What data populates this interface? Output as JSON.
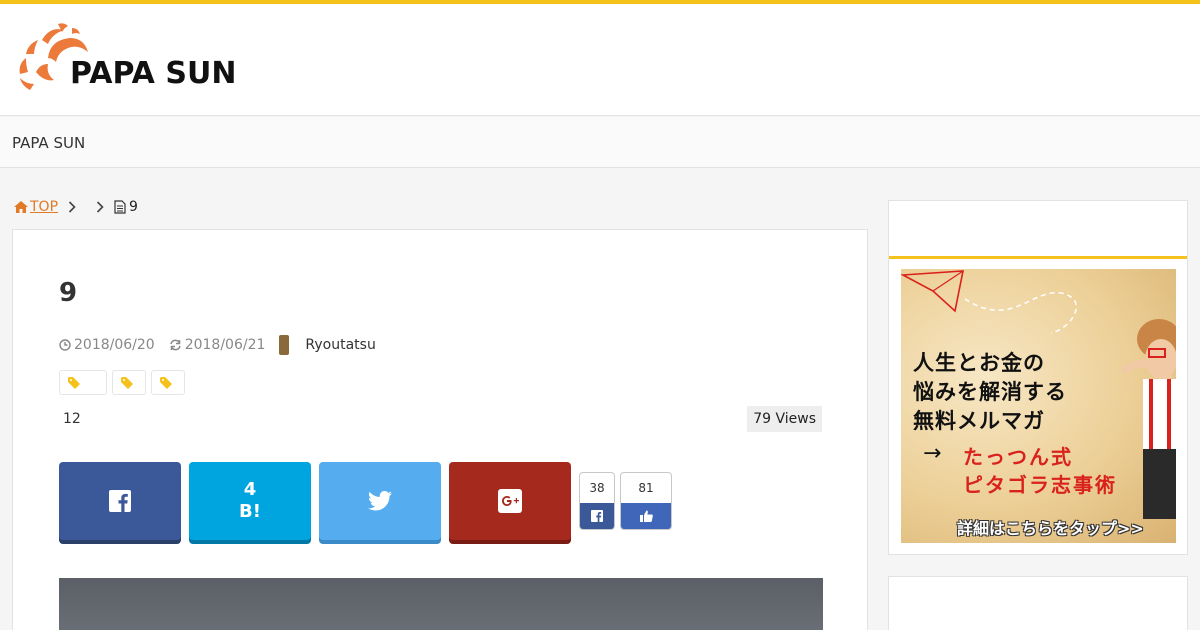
{
  "colors": {
    "accent": "#f4c21a",
    "link": "#e07a26",
    "facebook": "#3b5998",
    "hatena": "#00a4de",
    "twitter": "#55acee",
    "googleplus": "#a5291d"
  },
  "header": {
    "logo_text": "PAPA SUN"
  },
  "nav": {
    "site_name": "PAPA SUN"
  },
  "breadcrumb": {
    "home_label": "TOP",
    "current": "9"
  },
  "article": {
    "title": "9",
    "published": "2018/06/20",
    "updated": "2018/06/21",
    "author": "Ryoutatsu",
    "count": "12",
    "views": "79 Views",
    "share": {
      "hatena_count": "4",
      "hatena_label": "B!"
    },
    "counters": {
      "facebook_share": "38",
      "facebook_like": "81"
    }
  },
  "sidebar": {
    "banner": {
      "line1": "人生とお金の",
      "line2": "悩みを解消する",
      "line3": "無料メルマガ",
      "arrow": "→",
      "red1": "たっつん式",
      "red2": "ピタゴラ志事術",
      "cta": "詳細はこちらをタップ>>"
    }
  }
}
